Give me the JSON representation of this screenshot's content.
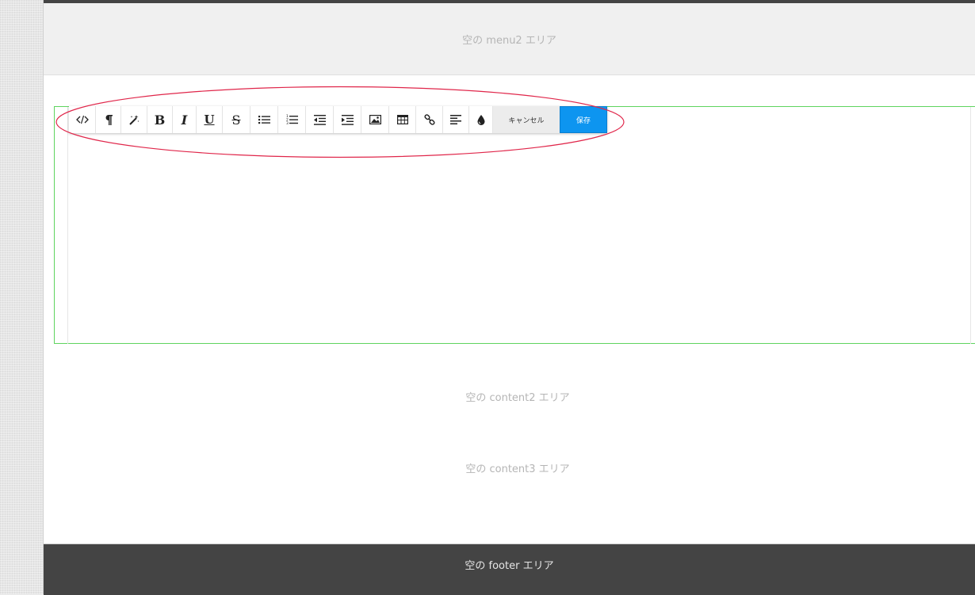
{
  "menu2": {
    "label": "空の menu2 エリア"
  },
  "toolbar": {
    "buttons": [
      {
        "name": "code-view-button",
        "icon": "code-icon"
      },
      {
        "name": "paragraph-button",
        "icon": "pilcrow-icon"
      },
      {
        "name": "magic-format-button",
        "icon": "magic-wand-icon"
      },
      {
        "name": "bold-button",
        "icon": "bold-icon",
        "text": "B"
      },
      {
        "name": "italic-button",
        "icon": "italic-icon",
        "text": "I"
      },
      {
        "name": "underline-button",
        "icon": "underline-icon",
        "text": "U"
      },
      {
        "name": "strikethrough-button",
        "icon": "strikethrough-icon",
        "text": "S"
      },
      {
        "name": "bullet-list-button",
        "icon": "bullet-list-icon"
      },
      {
        "name": "numbered-list-button",
        "icon": "numbered-list-icon"
      },
      {
        "name": "outdent-button",
        "icon": "outdent-icon"
      },
      {
        "name": "indent-button",
        "icon": "indent-icon"
      },
      {
        "name": "insert-image-button",
        "icon": "image-icon"
      },
      {
        "name": "insert-table-button",
        "icon": "table-icon"
      },
      {
        "name": "insert-link-button",
        "icon": "link-icon"
      },
      {
        "name": "align-button",
        "icon": "align-left-icon"
      },
      {
        "name": "color-button",
        "icon": "droplet-icon"
      }
    ],
    "cancel_label": "キャンセル",
    "save_label": "保存"
  },
  "content2": {
    "label": "空の content2 エリア"
  },
  "content3": {
    "label": "空の content3 エリア"
  },
  "footer": {
    "label": "空の footer エリア"
  },
  "colors": {
    "save_button": "#0d95f0",
    "editor_border": "#5fd45f",
    "highlight_oval": "#e0264a",
    "footer_bg": "#444444"
  }
}
